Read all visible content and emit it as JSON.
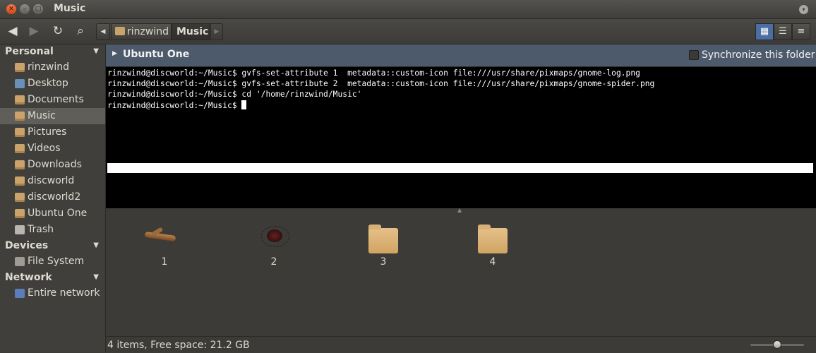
{
  "window": {
    "title": "Music"
  },
  "toolbar": {
    "back_icon": "back-arrow-icon",
    "forward_icon": "forward-arrow-icon",
    "reload_icon": "reload-icon",
    "search_icon": "search-icon",
    "breadcrumbs": [
      "rinzwind",
      "Music"
    ]
  },
  "sidebar": {
    "personal": {
      "heading": "Personal",
      "items": [
        {
          "label": "rinzwind",
          "icon": "home-folder-icon"
        },
        {
          "label": "Desktop",
          "icon": "desktop-icon"
        },
        {
          "label": "Documents",
          "icon": "documents-folder-icon"
        },
        {
          "label": "Music",
          "icon": "music-folder-icon",
          "selected": true
        },
        {
          "label": "Pictures",
          "icon": "pictures-folder-icon"
        },
        {
          "label": "Videos",
          "icon": "videos-folder-icon"
        },
        {
          "label": "Downloads",
          "icon": "downloads-folder-icon"
        },
        {
          "label": "discworld",
          "icon": "folder-icon"
        },
        {
          "label": "discworld2",
          "icon": "folder-icon"
        },
        {
          "label": "Ubuntu One",
          "icon": "ubuntu-one-folder-icon"
        },
        {
          "label": "Trash",
          "icon": "trash-icon"
        }
      ]
    },
    "devices": {
      "heading": "Devices",
      "items": [
        {
          "label": "File System",
          "icon": "filesystem-icon"
        }
      ]
    },
    "network": {
      "heading": "Network",
      "items": [
        {
          "label": "Entire network",
          "icon": "network-icon"
        }
      ]
    }
  },
  "ubuntu_one": {
    "title": "Ubuntu One",
    "sync_label": "Synchronize this folder",
    "sync_checked": false
  },
  "terminal": {
    "lines": [
      "rinzwind@discworld:~/Music$ gvfs-set-attribute 1  metadata::custom-icon file:///usr/share/pixmaps/gnome-log.png",
      "rinzwind@discworld:~/Music$ gvfs-set-attribute 2  metadata::custom-icon file:///usr/share/pixmaps/gnome-spider.png",
      "rinzwind@discworld:~/Music$ cd '/home/rinzwind/Music'",
      "rinzwind@discworld:~/Music$ "
    ]
  },
  "files": [
    {
      "name": "1",
      "icon": "log-icon"
    },
    {
      "name": "2",
      "icon": "spider-icon"
    },
    {
      "name": "3",
      "icon": "folder-icon"
    },
    {
      "name": "4",
      "icon": "folder-icon"
    }
  ],
  "status": {
    "text": "4 items, Free space: 21.2 GB",
    "zoom_level": 0.5
  }
}
